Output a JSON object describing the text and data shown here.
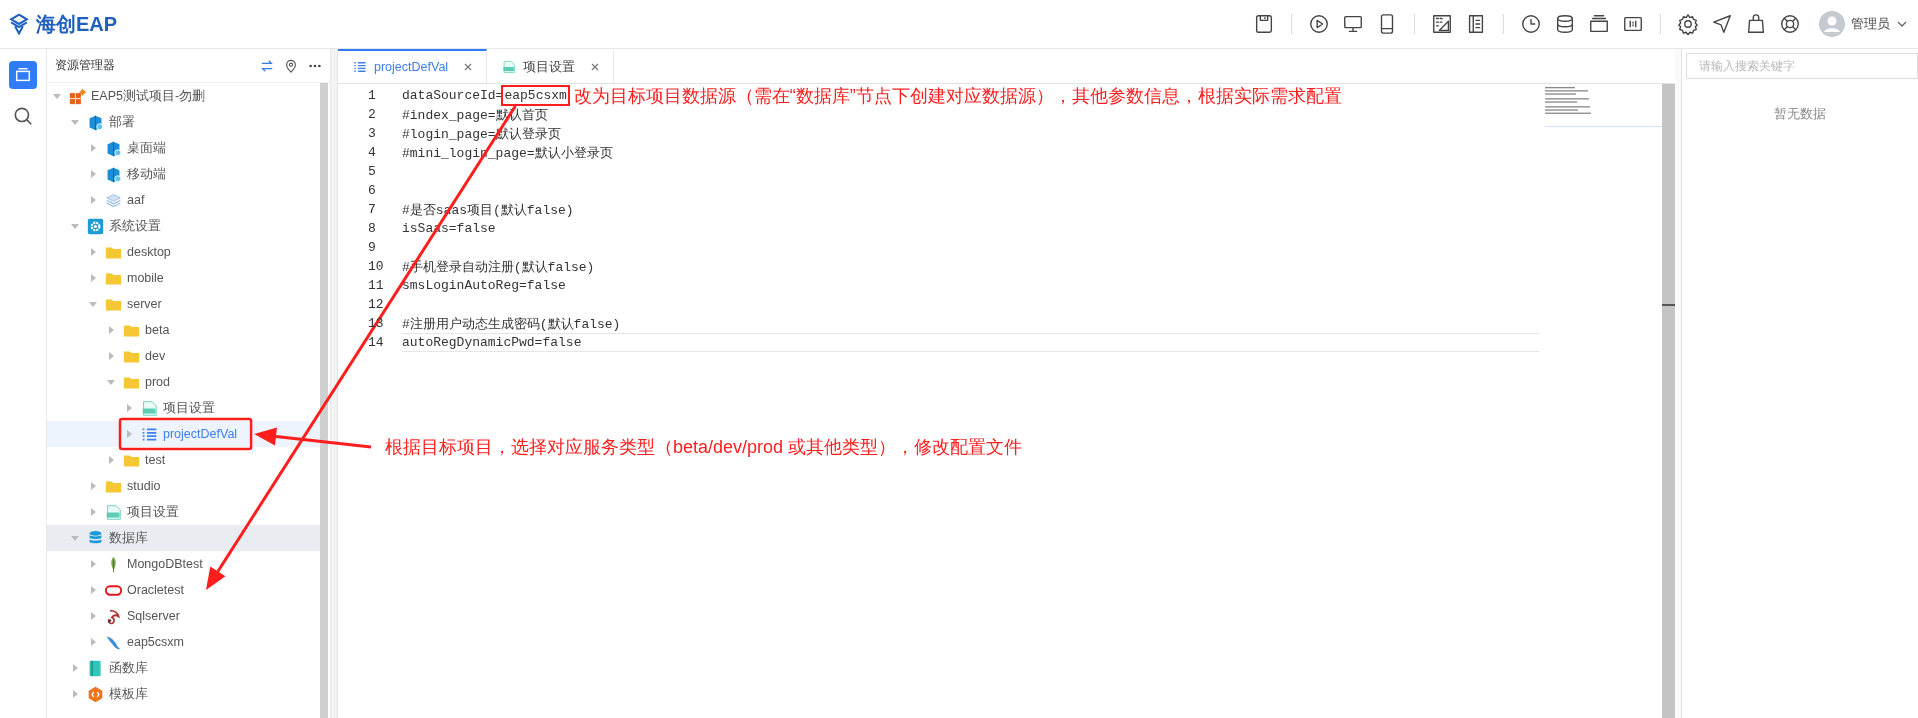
{
  "app": {
    "title": "海创EAP"
  },
  "user": {
    "name": "管理员"
  },
  "explorer": {
    "title": "资源管理器",
    "tree": [
      {
        "label": "EAP5测试项目-勿删",
        "kind": "project",
        "expanded": true,
        "selected": false,
        "hovered": false,
        "children": [
          {
            "label": "部署",
            "kind": "deploy",
            "expanded": true,
            "selected": false,
            "hovered": false,
            "children": [
              {
                "label": "桌面端",
                "kind": "deploy",
                "expanded": false,
                "selected": false,
                "hovered": false
              },
              {
                "label": "移动端",
                "kind": "deploy",
                "expanded": false,
                "selected": false,
                "hovered": false
              },
              {
                "label": "aaf",
                "kind": "layers",
                "expanded": false,
                "selected": false,
                "hovered": false
              }
            ]
          },
          {
            "label": "系统设置",
            "kind": "settings",
            "expanded": true,
            "selected": false,
            "hovered": false,
            "children": [
              {
                "label": "desktop",
                "kind": "folder",
                "expanded": false,
                "selected": false,
                "hovered": false
              },
              {
                "label": "mobile",
                "kind": "folder",
                "expanded": false,
                "selected": false,
                "hovered": false
              },
              {
                "label": "server",
                "kind": "folder",
                "expanded": true,
                "selected": false,
                "hovered": false,
                "children": [
                  {
                    "label": "beta",
                    "kind": "folder",
                    "expanded": false,
                    "selected": false,
                    "hovered": false
                  },
                  {
                    "label": "dev",
                    "kind": "folder",
                    "expanded": false,
                    "selected": false,
                    "hovered": false
                  },
                  {
                    "label": "prod",
                    "kind": "folder",
                    "expanded": true,
                    "selected": false,
                    "hovered": false,
                    "children": [
                      {
                        "label": "项目设置",
                        "kind": "yml",
                        "expanded": false,
                        "selected": false,
                        "hovered": false
                      },
                      {
                        "label": "projectDefVal",
                        "kind": "list",
                        "expanded": false,
                        "selected": true,
                        "hovered": false
                      }
                    ]
                  },
                  {
                    "label": "test",
                    "kind": "folder",
                    "expanded": false,
                    "selected": false,
                    "hovered": false
                  }
                ]
              },
              {
                "label": "studio",
                "kind": "folder",
                "expanded": false,
                "selected": false,
                "hovered": false
              },
              {
                "label": "项目设置",
                "kind": "yml",
                "expanded": false,
                "selected": false,
                "hovered": false
              }
            ]
          },
          {
            "label": "数据库",
            "kind": "database",
            "expanded": true,
            "selected": false,
            "hovered": true,
            "children": [
              {
                "label": "MongoDBtest",
                "kind": "mongo",
                "expanded": false,
                "selected": false,
                "hovered": false
              },
              {
                "label": "Oracletest",
                "kind": "oracle",
                "expanded": false,
                "selected": false,
                "hovered": false
              },
              {
                "label": "Sqlserver",
                "kind": "sqlserver",
                "expanded": false,
                "selected": false,
                "hovered": false
              },
              {
                "label": "eap5csxm",
                "kind": "mysql",
                "expanded": false,
                "selected": false,
                "hovered": false
              }
            ]
          },
          {
            "label": "函数库",
            "kind": "function",
            "expanded": false,
            "selected": false,
            "hovered": false
          },
          {
            "label": "模板库",
            "kind": "template",
            "expanded": false,
            "selected": false,
            "hovered": false
          }
        ]
      }
    ]
  },
  "tabs": [
    {
      "label": "projectDefVal",
      "kind": "list",
      "selected": true
    },
    {
      "label": "项目设置",
      "kind": "yml",
      "selected": false
    }
  ],
  "editor": {
    "lines": [
      {
        "number": "1",
        "text": "dataSourceId=",
        "marked": "eap5csxm",
        "current": false
      },
      {
        "number": "2",
        "text": "#index_page=默认首页",
        "current": false
      },
      {
        "number": "3",
        "text": "#login_page=默认登录页",
        "current": false
      },
      {
        "number": "4",
        "text": "#mini_login_page=默认小登录页",
        "current": false
      },
      {
        "number": "5",
        "current": false
      },
      {
        "number": "6",
        "current": false
      },
      {
        "number": "7",
        "text": "#是否saas项目(默认false)",
        "current": false
      },
      {
        "number": "8",
        "text": "isSaas=false",
        "current": false
      },
      {
        "number": "9",
        "current": false
      },
      {
        "number": "10",
        "text": "#手机登录自动注册(默认false)",
        "current": false
      },
      {
        "number": "11",
        "text": "smsLoginAutoReg=false",
        "current": false
      },
      {
        "number": "12",
        "current": false
      },
      {
        "number": "13",
        "text": "#注册用户动态生成密码(默认false)",
        "current": false
      },
      {
        "number": "14",
        "text": "autoRegDynamicPwd=false",
        "current": true
      }
    ]
  },
  "search": {
    "placeholder": "请输入搜索关键字"
  },
  "results": {
    "empty_text": "暂无数据"
  },
  "callouts": [
    {
      "kind": "source",
      "text": "改为目标项目数据源（需在“数据库”节点下创建对应数据源），其他参数信息，根据实际需求配置"
    },
    {
      "kind": "service",
      "text": "根据目标项目，选择对应服务类型（beta/dev/prod  或其他类型），修改配置文件"
    }
  ]
}
